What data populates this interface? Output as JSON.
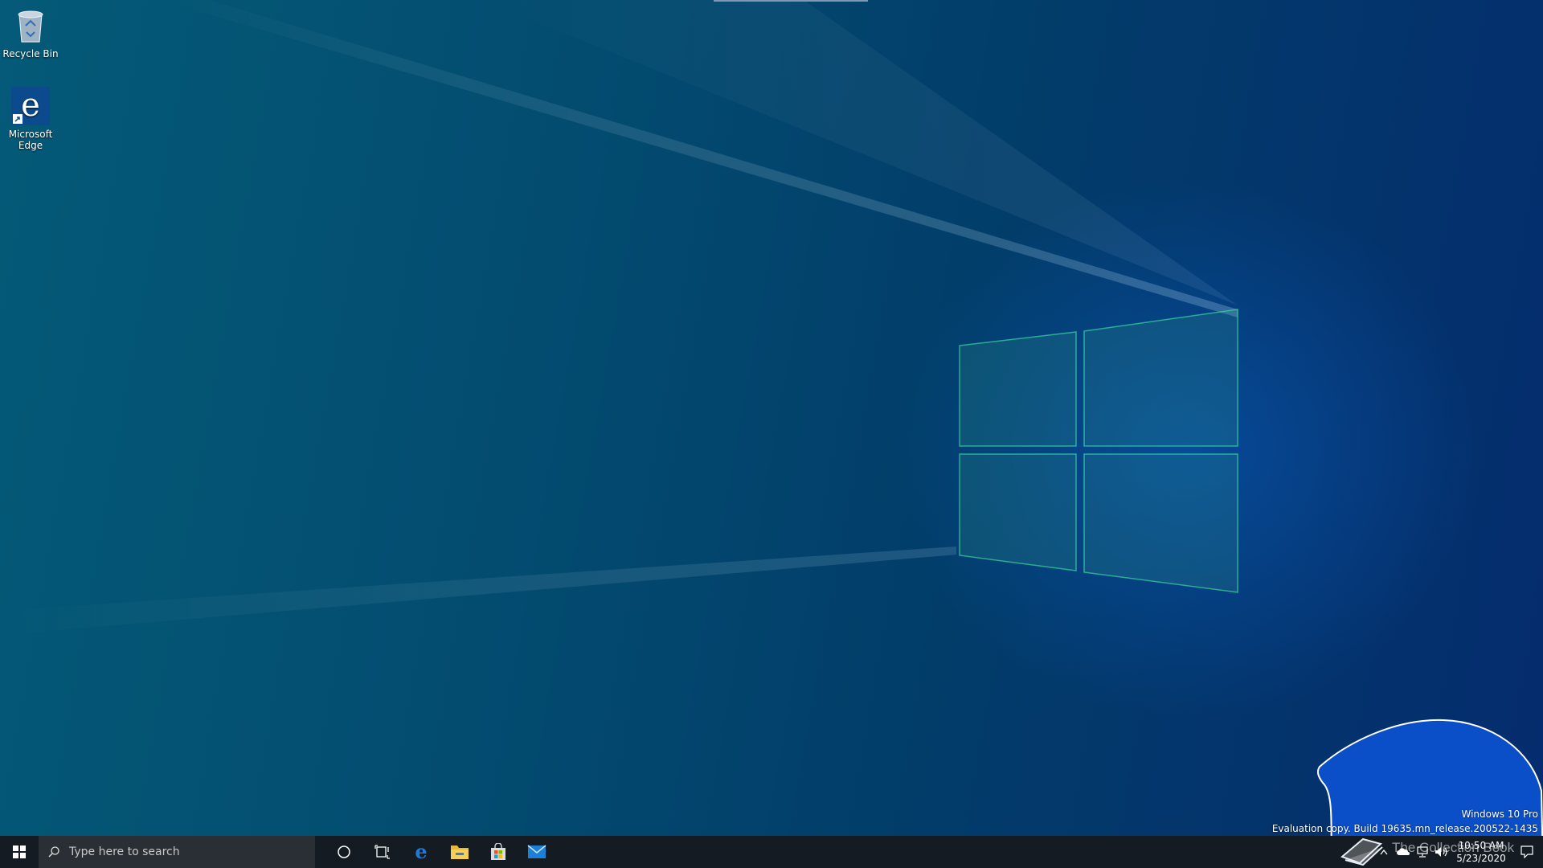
{
  "desktop": {
    "icons": [
      {
        "label": "Recycle Bin",
        "icon": "recycle-bin-icon"
      },
      {
        "label": "Microsoft Edge",
        "icon": "edge-icon"
      }
    ]
  },
  "taskbar": {
    "search_placeholder": "Type here to search",
    "pinned": [
      {
        "name": "cortana",
        "icon": "cortana-circle-icon"
      },
      {
        "name": "task-view",
        "icon": "task-view-icon"
      },
      {
        "name": "edge",
        "icon": "edge-icon"
      },
      {
        "name": "file-explorer",
        "icon": "folder-icon"
      },
      {
        "name": "store",
        "icon": "store-bag-icon"
      },
      {
        "name": "mail",
        "icon": "mail-icon"
      }
    ]
  },
  "watermark": {
    "line1": "Windows 10 Pro",
    "line2": "Evaluation copy. Build 19635.mn_release.200522-1435"
  },
  "overlay": {
    "stamp_text": "The Collection Book"
  },
  "tray": {
    "time": "10:50 AM",
    "date": "5/23/2020"
  },
  "colors": {
    "taskbar": "#151b22",
    "blob": "#0a4fc8",
    "logo_edge": "#38d8a0",
    "accent": "#0078d7"
  }
}
